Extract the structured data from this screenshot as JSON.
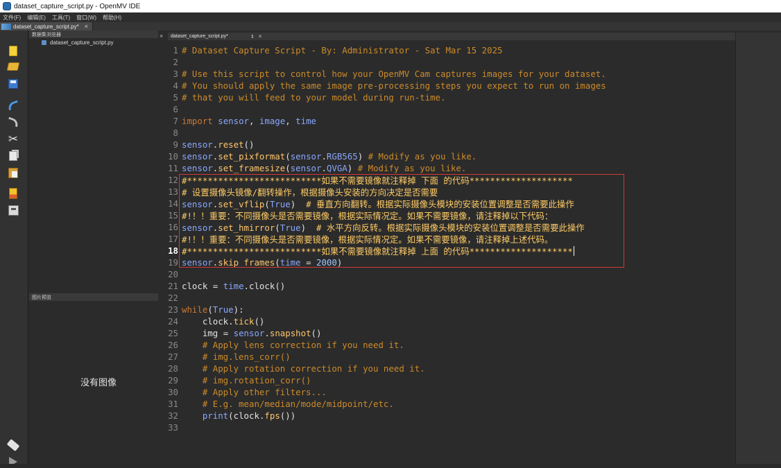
{
  "window": {
    "title": "dataset_capture_script.py - OpenMV IDE"
  },
  "menu": [
    "文件(F)",
    "编辑(E)",
    "工具(T)",
    "窗口(W)",
    "帮助(H)"
  ],
  "doc_tab": {
    "label": "dataset_capture_script.py*",
    "close": "×"
  },
  "toolbar": {
    "icons": [
      "new-file-icon",
      "open-folder-icon",
      "save-icon",
      "undo-icon",
      "redo-icon",
      "cut-icon",
      "copy-icon",
      "paste-icon",
      "memory-icon",
      "disk-icon",
      "connect-icon",
      "run-icon"
    ]
  },
  "explorer": {
    "header": "数据集浏览器",
    "items": [
      {
        "label": "dataset_capture_script.py"
      }
    ]
  },
  "preview": {
    "header": "图片预览",
    "empty_text": "没有图像"
  },
  "splitter": {
    "close": "×"
  },
  "editor_tab": {
    "label": "dataset_capture_script.py*",
    "arrows": "⇕",
    "close": "×"
  },
  "editor": {
    "active_line": 18,
    "lines": [
      {
        "n": "1",
        "code": "# Dataset Capture Script - By: Administrator - Sat Mar 15 2025"
      },
      {
        "n": "2",
        "code": ""
      },
      {
        "n": "3",
        "code": "# Use this script to control how your OpenMV Cam captures images for your dataset."
      },
      {
        "n": "4",
        "code": "# You should apply the same image pre-processing steps you expect to run on images"
      },
      {
        "n": "5",
        "code": "# that you will feed to your model during run-time."
      },
      {
        "n": "6",
        "code": ""
      },
      {
        "n": "7",
        "code": "import sensor, image, time"
      },
      {
        "n": "8",
        "code": ""
      },
      {
        "n": "9",
        "code": "sensor.reset()"
      },
      {
        "n": "10",
        "code": "sensor.set_pixformat(sensor.RGB565) # Modify as you like."
      },
      {
        "n": "11",
        "code": "sensor.set_framesize(sensor.QVGA) # Modify as you like."
      },
      {
        "n": "12",
        "code": "#**************************如果不需要镜像就注释掉 下面 的代码********************"
      },
      {
        "n": "13",
        "code": "# 设置摄像头镜像/翻转操作，根据摄像头安装的方向决定是否需要"
      },
      {
        "n": "14",
        "code": "sensor.set_vflip(True)  # 垂直方向翻转。根据实际摄像头模块的安装位置调整是否需要此操作"
      },
      {
        "n": "15",
        "code": "#!！！重要：不同摄像头是否需要镜像，根据实际情况定。如果不需要镜像，请注释掉以下代码："
      },
      {
        "n": "16",
        "code": "sensor.set_hmirror(True)  # 水平方向反转。根据实际摄像头模块的安装位置调整是否需要此操作"
      },
      {
        "n": "17",
        "code": "#!！！重要：不同摄像头是否需要镜像，根据实际情况定。如果不需要镜像，请注释掉上述代码。"
      },
      {
        "n": "18",
        "code": "#**************************如果不需要镜像就注释掉 上面 的代码********************"
      },
      {
        "n": "19",
        "code": "sensor.skip_frames(time = 2000)"
      },
      {
        "n": "20",
        "code": ""
      },
      {
        "n": "21",
        "code": "clock = time.clock()"
      },
      {
        "n": "22",
        "code": ""
      },
      {
        "n": "23",
        "code": "while(True):"
      },
      {
        "n": "24",
        "code": "    clock.tick()"
      },
      {
        "n": "25",
        "code": "    img = sensor.snapshot()"
      },
      {
        "n": "26",
        "code": "    # Apply lens correction if you need it."
      },
      {
        "n": "27",
        "code": "    # img.lens_corr()"
      },
      {
        "n": "28",
        "code": "    # Apply rotation correction if you need it."
      },
      {
        "n": "29",
        "code": "    # img.rotation_corr()"
      },
      {
        "n": "30",
        "code": "    # Apply other filters..."
      },
      {
        "n": "31",
        "code": "    # E.g. mean/median/mode/midpoint/etc."
      },
      {
        "n": "32",
        "code": "    print(clock.fps())"
      },
      {
        "n": "33",
        "code": ""
      }
    ]
  },
  "colors": {
    "background": "#2b2b2b",
    "comment": "#cc8b2a",
    "keyword": "#cc7832",
    "highlight_box": "#d33a3a"
  }
}
